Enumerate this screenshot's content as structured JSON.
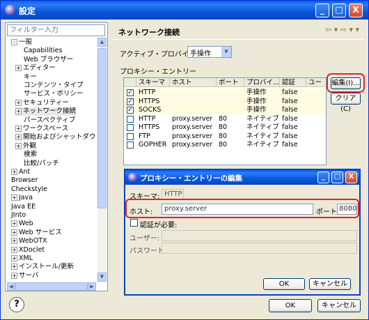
{
  "window": {
    "title": "設定",
    "buttons": {
      "minimize": "_",
      "maximize": "□",
      "close": "X"
    }
  },
  "tree": {
    "filter_placeholder": "フィルター入力",
    "items": [
      {
        "label": "一般",
        "expander": "-",
        "level": 0
      },
      {
        "label": "Capabilities",
        "expander": "",
        "level": 2
      },
      {
        "label": "Web ブラウザー",
        "expander": "",
        "level": 2
      },
      {
        "label": "エディター",
        "expander": "+",
        "level": 1
      },
      {
        "label": "キー",
        "expander": "",
        "level": 2
      },
      {
        "label": "コンテンツ・タイプ",
        "expander": "",
        "level": 2
      },
      {
        "label": "サービス・ポリシー",
        "expander": "",
        "level": 2
      },
      {
        "label": "セキュリティー",
        "expander": "+",
        "level": 1
      },
      {
        "label": "ネットワーク接続",
        "expander": "+",
        "level": 1
      },
      {
        "label": "パースペクティブ",
        "expander": "",
        "level": 2
      },
      {
        "label": "ワークスペース",
        "expander": "+",
        "level": 1
      },
      {
        "label": "開始およびシャットダウ",
        "expander": "+",
        "level": 1
      },
      {
        "label": "外観",
        "expander": "+",
        "level": 1
      },
      {
        "label": "検索",
        "expander": "",
        "level": 2
      },
      {
        "label": "比較/パッチ",
        "expander": "",
        "level": 2
      },
      {
        "label": "Ant",
        "expander": "+",
        "level": 0
      },
      {
        "label": "Browser",
        "expander": "",
        "level": 0
      },
      {
        "label": "Checkstyle",
        "expander": "",
        "level": 0
      },
      {
        "label": "Java",
        "expander": "+",
        "level": 0
      },
      {
        "label": "Java EE",
        "expander": "",
        "level": 0
      },
      {
        "label": "JInto",
        "expander": "",
        "level": 0
      },
      {
        "label": "Web",
        "expander": "+",
        "level": 0
      },
      {
        "label": "Web サービス",
        "expander": "+",
        "level": 0
      },
      {
        "label": "WebOTX",
        "expander": "+",
        "level": 0
      },
      {
        "label": "XDoclet",
        "expander": "+",
        "level": 0
      },
      {
        "label": "XML",
        "expander": "+",
        "level": 0
      },
      {
        "label": "インストール/更新",
        "expander": "+",
        "level": 0
      },
      {
        "label": "サーバ",
        "expander": "+",
        "level": 0
      }
    ]
  },
  "panel": {
    "title": "ネットワーク接続",
    "nav": "⇦ ▾ ⇨ ▾ ▾",
    "active_provider_label": "アクティブ・プロバイダー:",
    "active_provider_value": "手操作",
    "proxy_entries_label": "プロキシー・エントリー",
    "columns": [
      "",
      "スキーマ",
      "ホスト",
      "ポート",
      "プロバイ...",
      "認証",
      "ユー"
    ],
    "rows": [
      {
        "checked": true,
        "schema": "HTTP",
        "host": "",
        "port": "",
        "provider": "手操作",
        "auth": "false"
      },
      {
        "checked": true,
        "schema": "HTTPS",
        "host": "",
        "port": "",
        "provider": "手操作",
        "auth": "false"
      },
      {
        "checked": true,
        "schema": "SOCKS",
        "host": "",
        "port": "",
        "provider": "手操作",
        "auth": "false"
      },
      {
        "checked": false,
        "schema": "HTTP",
        "host": "proxy.server",
        "port": "80",
        "provider": "ネイティブ",
        "auth": "false"
      },
      {
        "checked": false,
        "schema": "HTTPS",
        "host": "proxy.server",
        "port": "80",
        "provider": "ネイティブ",
        "auth": "false"
      },
      {
        "checked": false,
        "schema": "FTP",
        "host": "proxy.server",
        "port": "80",
        "provider": "ネイティブ",
        "auth": "false"
      },
      {
        "checked": false,
        "schema": "GOPHER",
        "host": "proxy.server",
        "port": "80",
        "provider": "ネイティブ",
        "auth": "false"
      }
    ],
    "edit_button": "編集(I)...",
    "clear_button": "クリア(C)"
  },
  "footer": {
    "help": "?",
    "ok": "OK",
    "cancel": "キャンセル"
  },
  "dialog": {
    "title": "プロキシー・エントリーの編集",
    "buttons": {
      "minimize": "_",
      "maximize": "□",
      "close": "X"
    },
    "schema_label": "スキーマ:",
    "schema_value": "HTTP",
    "host_label": "ホスト:",
    "host_value": "proxy.server",
    "port_label": "ポート:",
    "port_value": "8080",
    "auth_required": "認証が必要:",
    "user_label": "ユーザー:",
    "password_label": "パスワード:",
    "ok": "OK",
    "cancel": "キャンセル"
  },
  "colors": {
    "titlebar": "#0a57d8",
    "highlight_outline": "#e8202a",
    "window_bg": "#ece9d8"
  }
}
